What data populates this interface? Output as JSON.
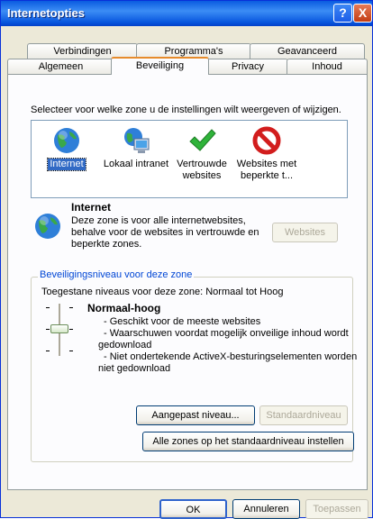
{
  "window": {
    "title": "Internetopties",
    "help_button": "?",
    "close_button": "X"
  },
  "tabs": {
    "row1": [
      "Verbindingen",
      "Programma's",
      "Geavanceerd"
    ],
    "row2": [
      "Algemeen",
      "Beveiliging",
      "Privacy",
      "Inhoud"
    ],
    "active": "Beveiliging"
  },
  "instruction": "Selecteer voor welke zone u de instellingen wilt weergeven of wijzigen.",
  "zones": [
    {
      "line1": "Internet",
      "line2": "",
      "icon": "globe-icon",
      "selected": true
    },
    {
      "line1": "Lokaal intranet",
      "line2": "",
      "icon": "intranet-icon",
      "selected": false
    },
    {
      "line1": "Vertrouwde",
      "line2": "websites",
      "icon": "checkmark-icon",
      "selected": false
    },
    {
      "line1": "Websites met",
      "line2": "beperkte t...",
      "icon": "restricted-icon",
      "selected": false
    }
  ],
  "zone_info": {
    "title": "Internet",
    "line1": "Deze zone is voor alle internetwebsites,",
    "line2": "behalve voor de websites in vertrouwde en",
    "line3": "beperkte zones.",
    "websites_button": "Websites"
  },
  "security_level": {
    "group_label": "Beveiligingsniveau voor deze zone",
    "allowed": "Toegestane niveaus voor deze zone: Normaal tot Hoog",
    "level_title": "Normaal-hoog",
    "desc1": "- Geschikt voor de meeste websites",
    "desc2": "- Waarschuwen voordat mogelijk onveilige inhoud wordt",
    "desc3": "gedownload",
    "desc4": "- Niet ondertekende ActiveX-besturingselementen worden",
    "desc5": "niet gedownload",
    "custom_button": "Aangepast niveau...",
    "default_button": "Standaardniveau",
    "reset_all_button": "Alle zones op het standaardniveau instellen"
  },
  "footer": {
    "ok": "OK",
    "cancel": "Annuleren",
    "apply": "Toepassen"
  },
  "colors": {
    "titlebar": "#0a5be0",
    "selection": "#316ac5",
    "group_label": "#0046d5"
  }
}
